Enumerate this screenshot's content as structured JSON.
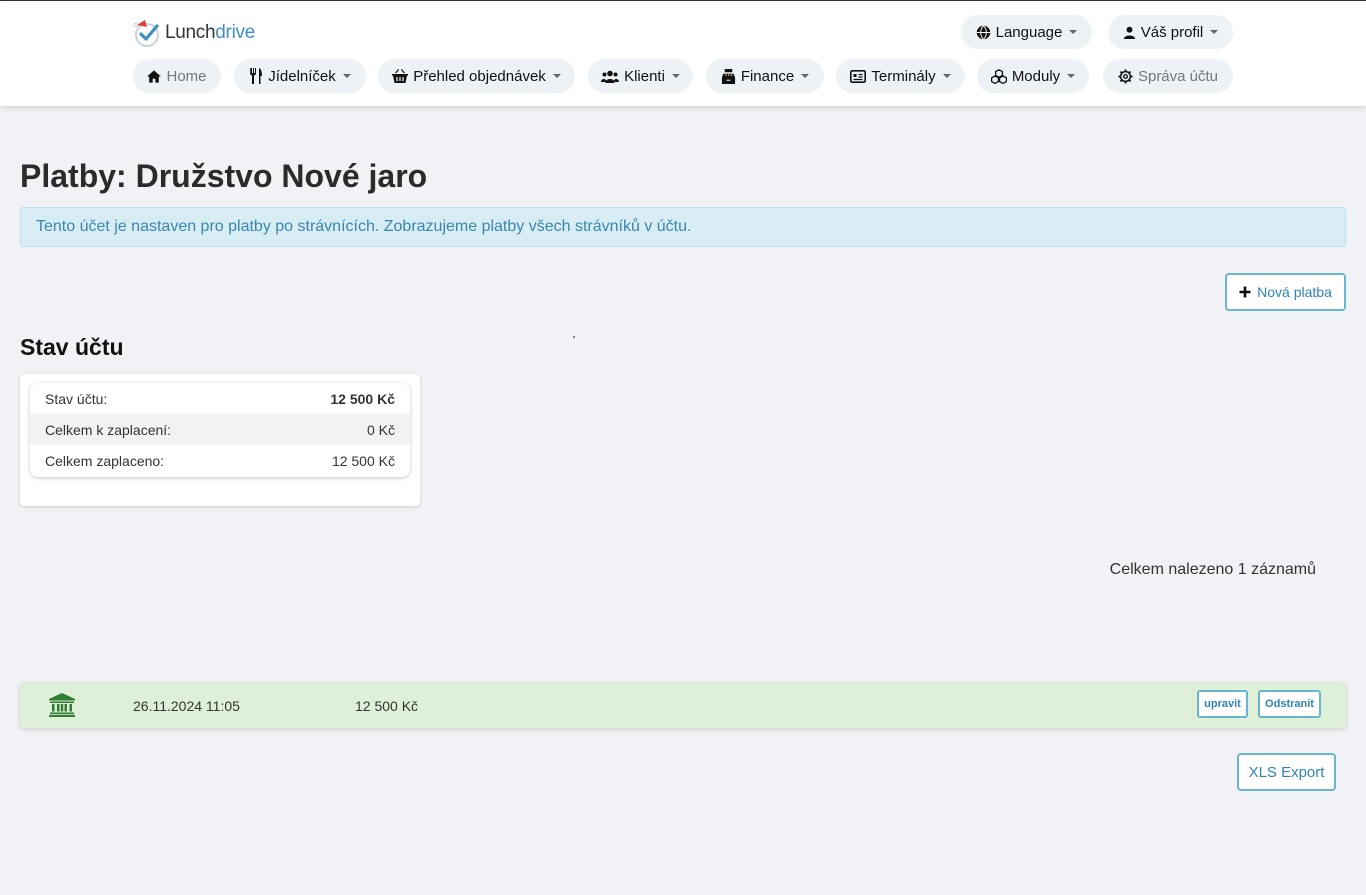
{
  "brand": {
    "name_part1": "Lunch",
    "name_part2": "drive"
  },
  "top_nav": {
    "language": "Language",
    "profile": "Váš profil"
  },
  "nav": {
    "home": "Home",
    "menu": "Jídelníček",
    "orders": "Přehled objednávek",
    "clients": "Klienti",
    "finance": "Finance",
    "terminals": "Terminály",
    "modules": "Moduly",
    "account": "Správa účtu"
  },
  "page": {
    "title": "Platby: Družstvo Nové jaro",
    "alert": "Tento účet je nastaven pro platby po strávnících. Zobrazujeme platby všech strávníků v účtu.",
    "new_payment": "Nová platba"
  },
  "account_status": {
    "heading": "Stav účtu",
    "rows": [
      {
        "label": "Stav účtu:",
        "value": "12 500 Kč"
      },
      {
        "label": "Celkem k zaplacení:",
        "value": "0 Kč"
      },
      {
        "label": "Celkem zaplaceno:",
        "value": "12 500 Kč"
      }
    ]
  },
  "records_found": "Celkem nalezeno 1 záznamů",
  "payments": [
    {
      "icon": "bank-icon",
      "date": "26.11.2024 11:05",
      "amount": "12 500 Kč",
      "edit": "upravit",
      "delete": "Odstranit"
    }
  ],
  "export": "XLS Export",
  "colors": {
    "accent": "#2d84b5",
    "alert_bg": "#d8ecf4",
    "alert_text": "#3a87ad",
    "success_bg": "#dff0d8",
    "bank_icon": "#2e7d32"
  }
}
